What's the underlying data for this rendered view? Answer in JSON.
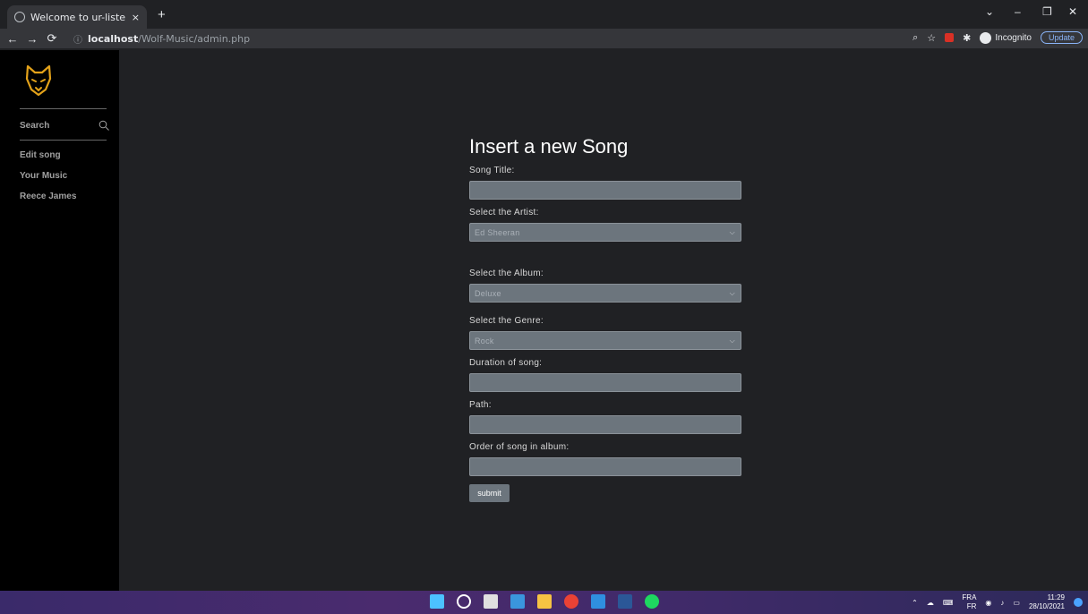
{
  "browser": {
    "tab_title": "Welcome to ur-listening",
    "tab_close": "×",
    "new_tab": "+",
    "url_host": "localhost",
    "url_path": "/Wolf-Music/admin.php",
    "incognito_label": "Incognito",
    "update_label": "Update"
  },
  "sidebar": {
    "search_label": "Search",
    "links": [
      "Edit song",
      "Your Music",
      "Reece James"
    ]
  },
  "form": {
    "title": "Insert a new Song",
    "song_title_label": "Song Title:",
    "artist_label": "Select the Artist:",
    "artist_value": "Ed Sheeran",
    "album_label": "Select the Album:",
    "album_value": "Deluxe",
    "genre_label": "Select the Genre:",
    "genre_value": "Rock",
    "duration_label": "Duration of song:",
    "path_label": "Path:",
    "order_label": "Order of song in album:",
    "submit_label": "submit"
  },
  "taskbar": {
    "lang_top": "FRA",
    "lang_bottom": "FR",
    "time": "11:29",
    "date": "28/10/2021"
  },
  "colors": {
    "accent_logo": "#e3a21a",
    "background": "#202124",
    "sidebar": "#000000",
    "input": "#6c757d"
  }
}
